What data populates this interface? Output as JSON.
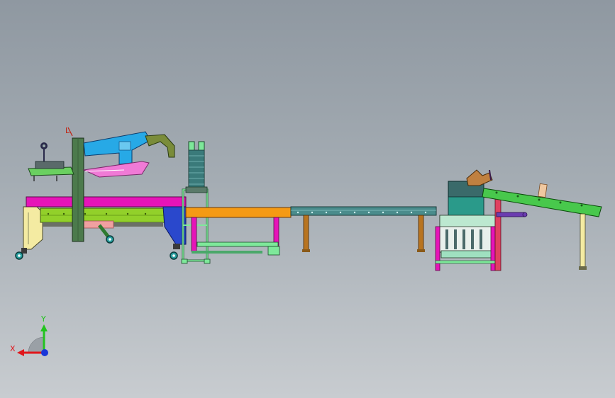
{
  "viewport": {
    "background_top": "#8f98a1",
    "background_bottom": "#c8ccd0"
  },
  "triad": {
    "x_label": "X",
    "y_label": "Y",
    "x_color": "#e0161b",
    "y_color": "#22c41e",
    "z_color": "#1936d8"
  },
  "annotation": {
    "marker_text": "L"
  },
  "colors": {
    "magenta_frame": "#e614b8",
    "olive_frame": "#92d02a",
    "dark_green_column": "#4c7a4c",
    "sky_blue_arm": "#27a9e6",
    "orange_conveyor": "#f59a14",
    "teal_roller_conveyor": "#4a8c8c",
    "brown_legs": "#b87420",
    "light_green_frame": "#7ee89a",
    "cream_frame": "#f4eba2",
    "pink_plate": "#f07ad6",
    "blue_panel": "#2a48cc",
    "green_ramp": "#48c84c",
    "dark_teal_box": "#3a6a6a",
    "purple_cylinder": "#6a3cb0"
  }
}
